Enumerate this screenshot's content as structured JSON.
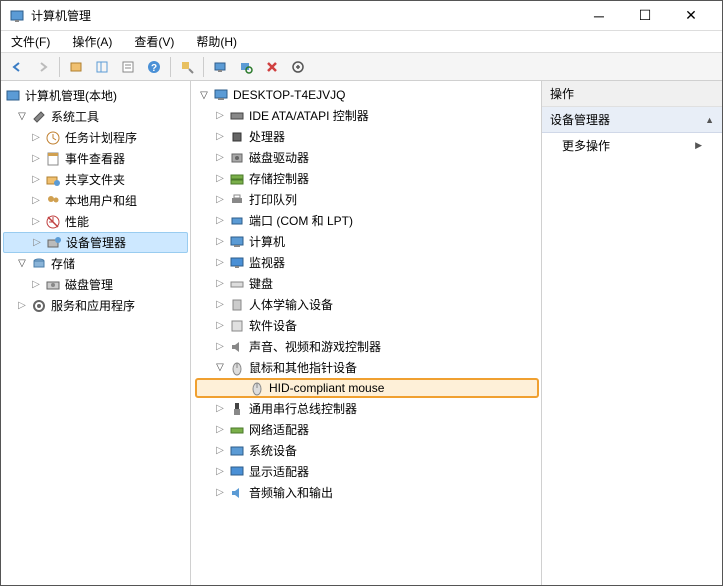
{
  "title": "计算机管理",
  "menubar": [
    "文件(F)",
    "操作(A)",
    "查看(V)",
    "帮助(H)"
  ],
  "left_tree": {
    "root": "计算机管理(本地)",
    "groups": [
      {
        "label": "系统工具",
        "expanded": true,
        "children": [
          {
            "label": "任务计划程序",
            "icon": "clock"
          },
          {
            "label": "事件查看器",
            "icon": "event"
          },
          {
            "label": "共享文件夹",
            "icon": "share"
          },
          {
            "label": "本地用户和组",
            "icon": "users"
          },
          {
            "label": "性能",
            "icon": "perf"
          },
          {
            "label": "设备管理器",
            "icon": "device",
            "selected": true
          }
        ]
      },
      {
        "label": "存储",
        "expanded": true,
        "children": [
          {
            "label": "磁盘管理",
            "icon": "disk"
          }
        ]
      },
      {
        "label": "服务和应用程序",
        "expanded": false,
        "children": []
      }
    ]
  },
  "device_tree": {
    "root": "DESKTOP-T4EJVJQ",
    "items": [
      {
        "label": "IDE ATA/ATAPI 控制器",
        "icon": "ide"
      },
      {
        "label": "处理器",
        "icon": "cpu"
      },
      {
        "label": "磁盘驱动器",
        "icon": "hdd"
      },
      {
        "label": "存储控制器",
        "icon": "storage"
      },
      {
        "label": "打印队列",
        "icon": "printer"
      },
      {
        "label": "端口 (COM 和 LPT)",
        "icon": "port"
      },
      {
        "label": "计算机",
        "icon": "pc"
      },
      {
        "label": "监视器",
        "icon": "monitor"
      },
      {
        "label": "键盘",
        "icon": "keyboard"
      },
      {
        "label": "人体学输入设备",
        "icon": "hid"
      },
      {
        "label": "软件设备",
        "icon": "software"
      },
      {
        "label": "声音、视频和游戏控制器",
        "icon": "sound"
      },
      {
        "label": "鼠标和其他指针设备",
        "icon": "mouse",
        "expanded": true,
        "children": [
          {
            "label": "HID-compliant mouse",
            "icon": "mouse",
            "highlight": true
          }
        ]
      },
      {
        "label": "通用串行总线控制器",
        "icon": "usb"
      },
      {
        "label": "网络适配器",
        "icon": "network"
      },
      {
        "label": "系统设备",
        "icon": "system"
      },
      {
        "label": "显示适配器",
        "icon": "display"
      },
      {
        "label": "音频输入和输出",
        "icon": "audio"
      }
    ]
  },
  "actions": {
    "header": "操作",
    "sub": "设备管理器",
    "more": "更多操作"
  }
}
